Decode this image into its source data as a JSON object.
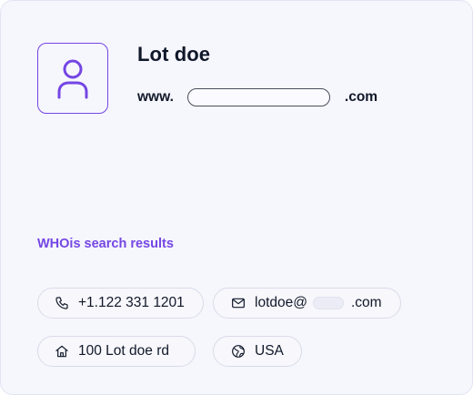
{
  "profile": {
    "name": "Lot doe",
    "website": {
      "prefix": "www.",
      "suffix": ".com"
    },
    "avatar_icon": "user-icon"
  },
  "section": {
    "title": "WHOis search results"
  },
  "details": {
    "phone": {
      "icon": "phone-icon",
      "value": "+1.122 331 1201"
    },
    "email": {
      "icon": "mail-icon",
      "user": "lotdoe@",
      "suffix": ".com"
    },
    "address": {
      "icon": "home-icon",
      "value": "100 Lot doe rd"
    },
    "country": {
      "icon": "globe-icon",
      "value": "USA"
    }
  },
  "colors": {
    "accent": "#7446e3",
    "card_bg": "#f6f6fd",
    "text": "#101828"
  }
}
